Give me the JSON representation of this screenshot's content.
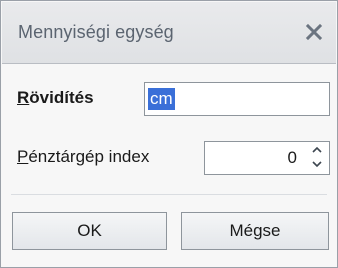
{
  "dialog": {
    "title": "Mennyiségi egység",
    "close_icon": "close-icon"
  },
  "fields": {
    "abbreviation": {
      "label_access_key": "R",
      "label_rest": "övidítés",
      "value": "cm"
    },
    "register_index": {
      "label_access_key": "P",
      "label_rest": "énztárgép index",
      "value": "0",
      "spinner_icons": [
        "chevron-up-icon",
        "chevron-down-icon"
      ]
    }
  },
  "buttons": {
    "ok_label": "OK",
    "cancel_label": "Mégse"
  },
  "colors": {
    "selection": "#3a6fd8",
    "title_text": "#5b6470",
    "border": "#8e959c"
  }
}
